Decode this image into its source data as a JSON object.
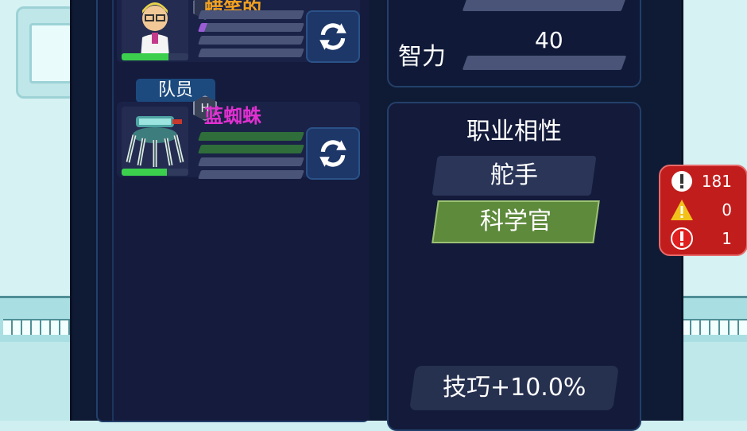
{
  "roster": {
    "members": [
      {
        "name": "蜡笑的",
        "role_tag": "",
        "badge": "",
        "skill_bars": 4,
        "hp_fraction": 0.7
      },
      {
        "name": "蓝蜘蛛",
        "role_tag": "队员",
        "badge": "H",
        "skill_bars": 4,
        "hp_fraction": 0.68
      }
    ]
  },
  "stats": {
    "label": "智力",
    "value": "40"
  },
  "affinity": {
    "title": "职业相性",
    "jobs": [
      "舵手",
      "科学官"
    ],
    "selected_job": "科学官",
    "bonus": "技巧+10.0%"
  },
  "alerts": {
    "info_count": "181",
    "warning_count": "0",
    "error_count": "1"
  },
  "colors": {
    "panel": "#0f1b34",
    "accent_green": "#5e8a3c",
    "alert_red": "#c21d1d",
    "name_orange": "#f0a020",
    "name_magenta": "#e030d0"
  }
}
